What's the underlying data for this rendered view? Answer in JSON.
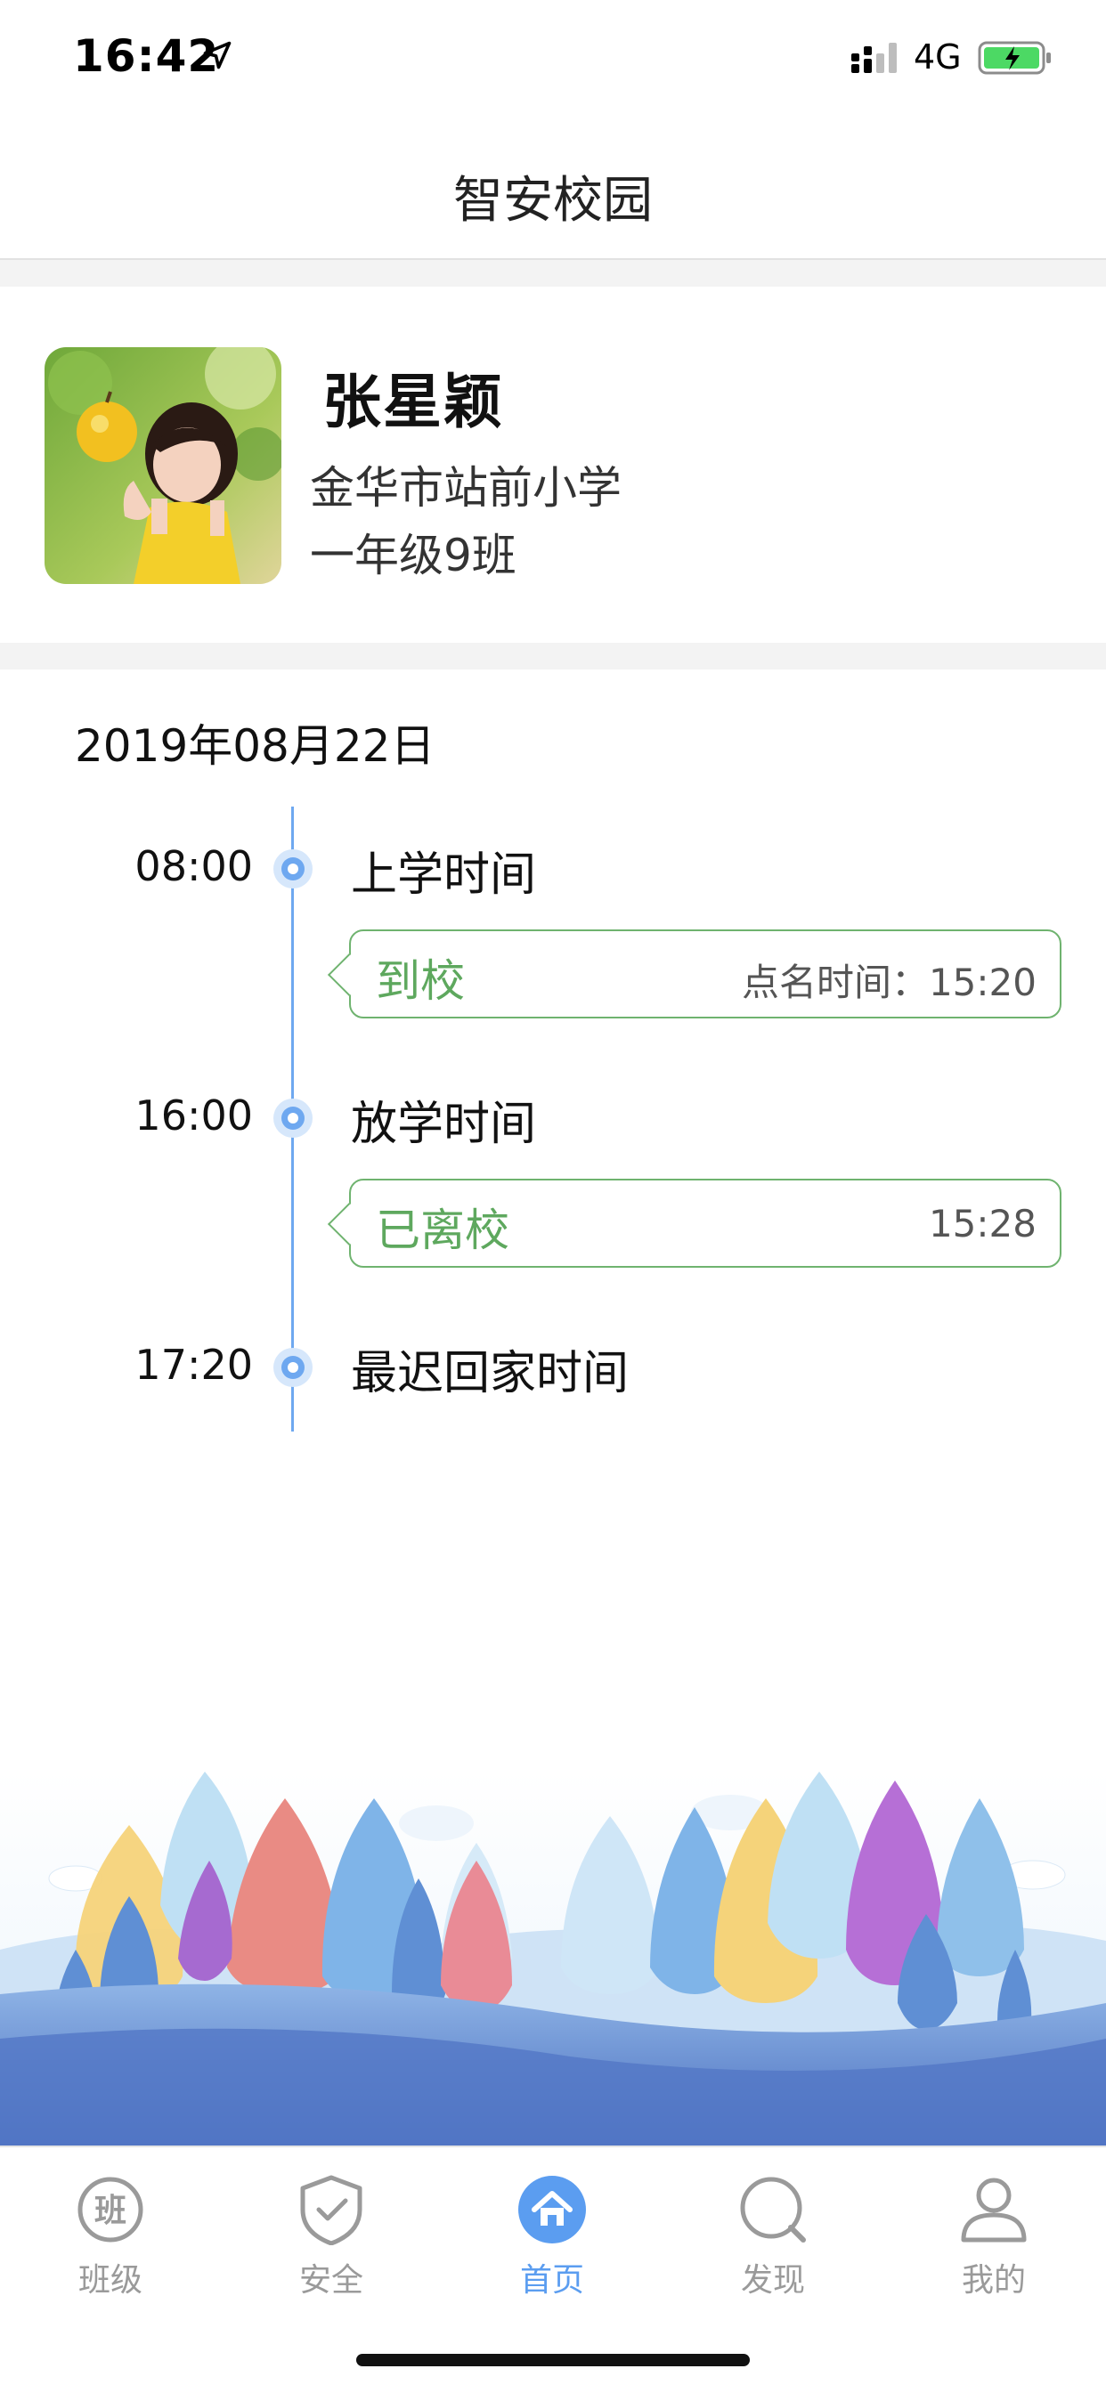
{
  "status_bar": {
    "time": "16:42",
    "network": "4G",
    "icons": [
      "location-arrow-icon",
      "signal-icon",
      "battery-charging-icon"
    ]
  },
  "header": {
    "title": "智安校园"
  },
  "profile": {
    "name": "张星颖",
    "school": "金华市站前小学",
    "class": "一年级9班"
  },
  "attendance": {
    "date": "2019年08月22日",
    "events": [
      {
        "time": "08:00",
        "label": "上学时间"
      },
      {
        "time": "16:00",
        "label": "放学时间"
      },
      {
        "time": "17:20",
        "label": "最迟回家时间"
      }
    ],
    "records": [
      {
        "status": "到校",
        "detail": "点名时间：15:20"
      },
      {
        "status": "已离校",
        "detail": "15:28"
      }
    ]
  },
  "tab_bar": {
    "items": [
      {
        "label": "班级",
        "icon": "class-icon",
        "icon_text": "班"
      },
      {
        "label": "安全",
        "icon": "shield-check-icon"
      },
      {
        "label": "首页",
        "icon": "home-icon",
        "active": true
      },
      {
        "label": "发现",
        "icon": "discover-icon"
      },
      {
        "label": "我的",
        "icon": "profile-icon"
      }
    ]
  },
  "colors": {
    "accent": "#5b9df0",
    "timeline": "#6ea8f0",
    "status_green": "#5ea85e",
    "tab_inactive": "#9a9a9a"
  }
}
